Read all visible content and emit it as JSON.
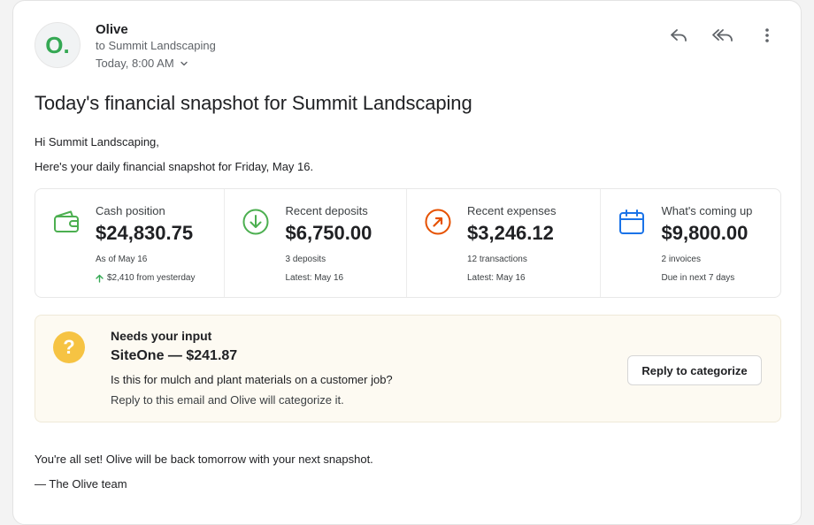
{
  "header": {
    "avatar_letter": "O.",
    "sender": "Olive",
    "to": "to Summit Landscaping",
    "date": "Today, 8:00 AM"
  },
  "subject": "Today's financial snapshot for Summit Landscaping",
  "body": {
    "greeting": "Hi Summit Landscaping,",
    "intro": "Here's your daily financial snapshot for Friday, May 16."
  },
  "stats": [
    {
      "label": "Cash position",
      "value": "$24,830.75",
      "sub1": "As of May 16",
      "sub2": "$2,410 from yesterday",
      "icon": "wallet-icon"
    },
    {
      "label": "Recent deposits",
      "value": "$6,750.00",
      "sub1": "3 deposits",
      "sub2": "Latest: May 16",
      "icon": "arrow-down-circle-icon"
    },
    {
      "label": "Recent expenses",
      "value": "$3,246.12",
      "sub1": "12 transactions",
      "sub2": "Latest: May 16",
      "icon": "arrow-up-right-circle-icon"
    },
    {
      "label": "What's coming up",
      "value": "$9,800.00",
      "sub1": "2 invoices",
      "sub2": "Due in next 7 days",
      "icon": "calendar-icon"
    }
  ],
  "needs_input": {
    "title": "Needs your input",
    "vendor": "SiteOne — $241.87",
    "question": "Is this for mulch and plant materials on a customer job?",
    "hint": "Reply to this email and Olive will categorize it.",
    "button": "Reply to categorize"
  },
  "closing": "You're all set! Olive will be back tomorrow with your next snapshot.",
  "signoff": "— The Olive team",
  "colors": {
    "brand_green": "#34a853",
    "deposit_green": "#4caf50",
    "expense_orange": "#e65100",
    "calendar_blue": "#1a73e8",
    "question_yellow": "#f6c343"
  }
}
